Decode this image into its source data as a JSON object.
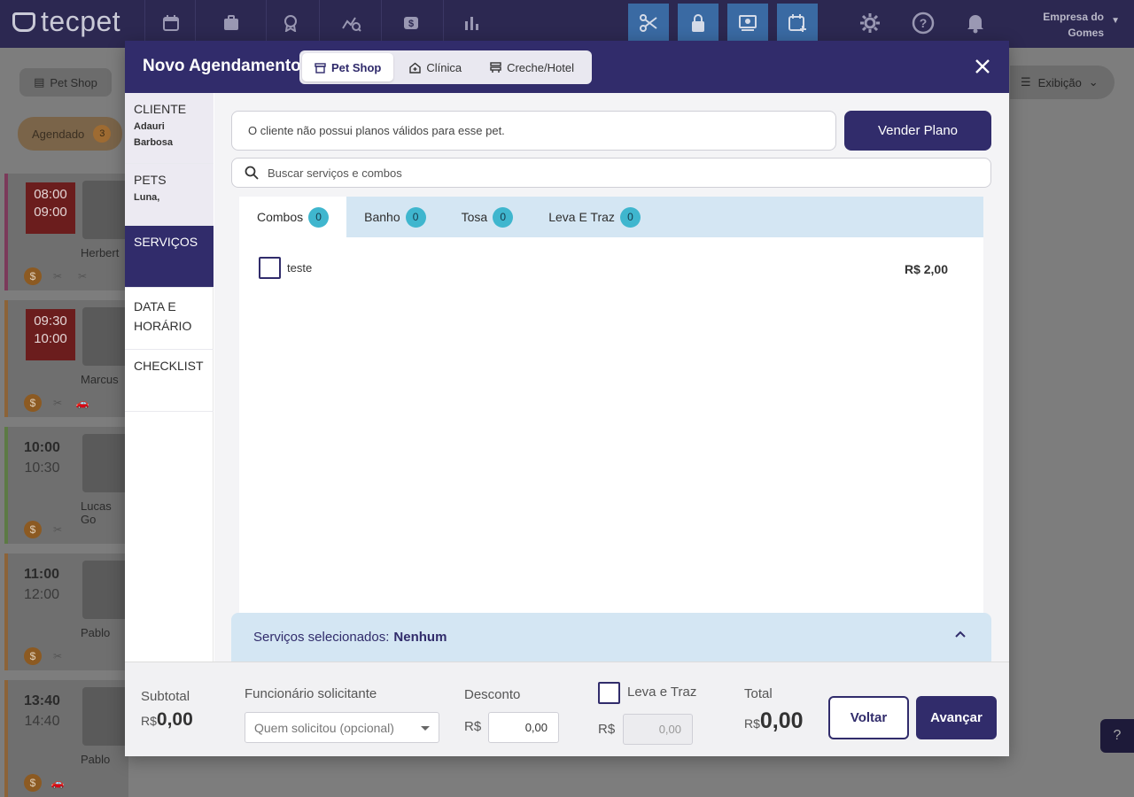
{
  "app": {
    "logo_text": "tecpet"
  },
  "topbar": {
    "icons": [
      "calendar-icon",
      "badge-icon",
      "award-icon",
      "analytics-icon",
      "dollar-icon",
      "bar-chart-icon",
      "scissors-icon",
      "lock-icon",
      "screen-icon",
      "calendar-plus-icon",
      "gear-icon",
      "help-icon",
      "bell-icon"
    ],
    "company_line1": "Empresa do",
    "company_line2": "Gomes"
  },
  "background": {
    "petshop_chip": "Pet Shop",
    "status_chip": "Agendado",
    "status_count": "3",
    "exibicao": "Exibição",
    "appointments": [
      {
        "start": "08:00",
        "end": "09:00",
        "name": "Herbert"
      },
      {
        "start": "09:30",
        "end": "10:00",
        "name": "Marcus"
      },
      {
        "start": "10:00",
        "end": "10:30",
        "name": "Lucas Go"
      },
      {
        "start": "11:00",
        "end": "12:00",
        "name": "Pablo"
      },
      {
        "start": "13:40",
        "end": "14:40",
        "name": "Pablo"
      }
    ]
  },
  "modal": {
    "title": "Novo Agendamento",
    "segments": [
      {
        "label": "Pet Shop",
        "icon": "store-icon",
        "active": true
      },
      {
        "label": "Clínica",
        "icon": "clinic-icon",
        "active": false
      },
      {
        "label": "Creche/Hotel",
        "icon": "hotel-icon",
        "active": false
      }
    ],
    "steps": {
      "cliente": {
        "label": "CLIENTE",
        "value_line1": "Adauri",
        "value_line2": "Barbosa"
      },
      "pets": {
        "label": "PETS",
        "value": "Luna,"
      },
      "servicos": {
        "label": "SERVIÇOS"
      },
      "data_line1": "DATA E",
      "data_line2": "HORÁRIO",
      "checklist": "CHECKLIST"
    },
    "plan_notice": "O cliente não possui planos válidos para esse pet.",
    "sell_plan_label": "Vender Plano",
    "search_placeholder": "Buscar serviços e combos",
    "tabs": [
      {
        "label": "Combos",
        "count": "0",
        "active": true
      },
      {
        "label": "Banho",
        "count": "0",
        "active": false
      },
      {
        "label": "Tosa",
        "count": "0",
        "active": false
      },
      {
        "label": "Leva E Traz",
        "count": "0",
        "active": false
      }
    ],
    "items": [
      {
        "label": "teste",
        "price": "R$ 2,00",
        "checked": false
      }
    ],
    "selected_label": "Serviços selecionados:",
    "selected_value": "Nenhum"
  },
  "footer": {
    "subtotal_label": "Subtotal",
    "subtotal_currency": "R$",
    "subtotal_value": "0,00",
    "employee_label": "Funcionário solicitante",
    "employee_placeholder": "Quem solicitou (opcional)",
    "discount_label": "Desconto",
    "discount_currency": "R$",
    "discount_value": "0,00",
    "leva_label": "Leva e Traz",
    "leva_currency": "R$",
    "leva_value": "0,00",
    "total_label": "Total",
    "total_currency": "R$",
    "total_value": "0,00",
    "back_label": "Voltar",
    "next_label": "Avançar"
  },
  "colors": {
    "primary": "#312c6b",
    "accent_tab": "#d4e6f3",
    "badge": "#3fb6ce"
  }
}
